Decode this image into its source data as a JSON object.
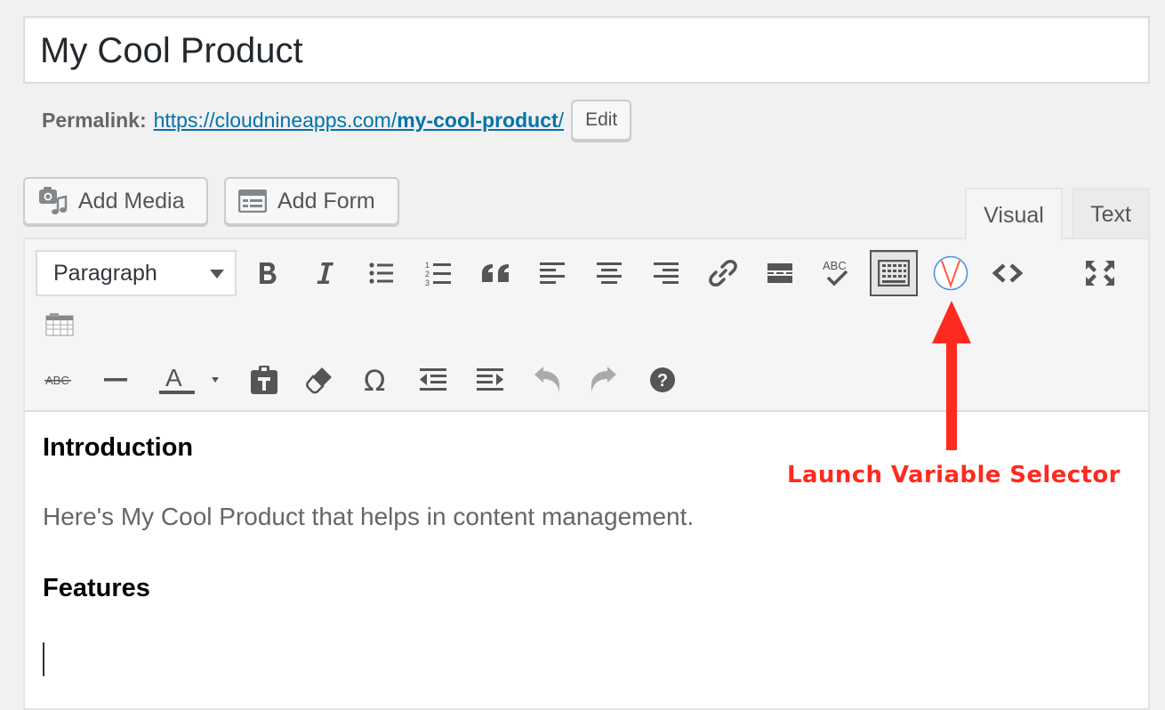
{
  "post": {
    "title": "My Cool Product"
  },
  "permalink": {
    "label": "Permalink:",
    "url_base": "https://cloudnineapps.com/",
    "url_slug": "my-cool-product",
    "url_end": "/",
    "edit_label": "Edit"
  },
  "media_buttons": {
    "add_media": "Add Media",
    "add_form": "Add Form"
  },
  "tabs": {
    "visual": "Visual",
    "text": "Text",
    "active": "Visual"
  },
  "toolbar": {
    "format_selected": "Paragraph",
    "row1_icons": [
      "bold-icon",
      "italic-icon",
      "bulleted-list-icon",
      "numbered-list-icon",
      "blockquote-icon",
      "align-left-icon",
      "align-center-icon",
      "align-right-icon",
      "link-icon",
      "read-more-icon",
      "spellcheck-icon",
      "toolbar-toggle-icon",
      "variable-selector-icon",
      "code-icon",
      "fullscreen-icon",
      "table-icon"
    ],
    "row2_icons": [
      "strikethrough-icon",
      "horizontal-line-icon",
      "text-color-icon",
      "paste-text-icon",
      "clear-formatting-icon",
      "special-character-icon",
      "outdent-icon",
      "indent-icon",
      "undo-icon",
      "redo-icon",
      "help-icon"
    ],
    "spellcheck_text": "ABC",
    "strikethrough_text": "ABC",
    "text_color_letter": "A",
    "numbered_list_digits": [
      "1",
      "2",
      "3"
    ],
    "help_text": "?",
    "special_char_text": "Ω"
  },
  "content": {
    "heading1": "Introduction",
    "paragraph1": "Here's My Cool Product that helps in content management.",
    "heading2": "Features"
  },
  "annotation": {
    "label": "Launch Variable Selector",
    "color": "#ff2a1f"
  },
  "colors": {
    "link": "#0073aa",
    "variable_icon": "#ff5a3c",
    "variable_ring": "#4a90e2"
  }
}
